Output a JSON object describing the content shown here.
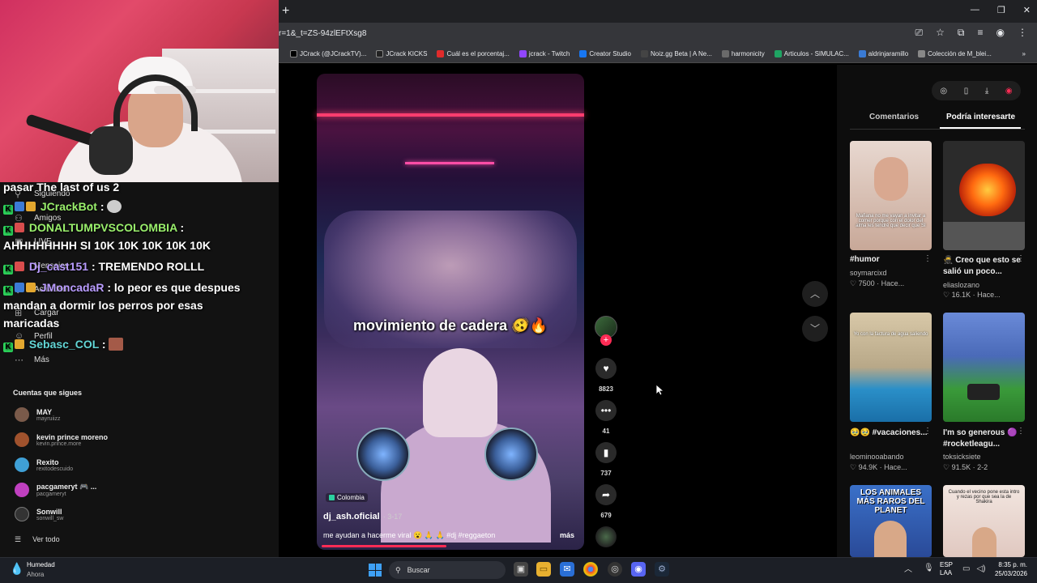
{
  "browser": {
    "url": "r=1&_t=ZS-94zlEFtXsg8",
    "bookmarks": [
      {
        "label": "JCrack (@JCrackTV)...",
        "color": "#000000"
      },
      {
        "label": "JCrack KICKS",
        "color": "#222222"
      },
      {
        "label": "Cuál es el porcentaj...",
        "color": "#e02b2b"
      },
      {
        "label": "jcrack - Twitch",
        "color": "#9146ff"
      },
      {
        "label": "Creator Studio",
        "color": "#1877f2"
      },
      {
        "label": "Noiz.gg Beta | A Ne...",
        "color": "#444444"
      },
      {
        "label": "harmonicity",
        "color": "#6a6a6a"
      },
      {
        "label": "Articulos - SIMULAC...",
        "color": "#1fa463"
      },
      {
        "label": "aldrinjaramillo",
        "color": "#3a7bd5"
      },
      {
        "label": "Colección de M_blei...",
        "color": "#888888"
      }
    ]
  },
  "sidebar": {
    "nav": [
      {
        "label": "Siguiendo",
        "icon": "following-icon"
      },
      {
        "label": "Amigos",
        "icon": "friends-icon"
      },
      {
        "label": "LIVE",
        "icon": "live-icon"
      },
      {
        "label": "Mensajes",
        "icon": "messages-icon"
      },
      {
        "label": "Actividad",
        "icon": "activity-icon"
      },
      {
        "label": "Cargar",
        "icon": "upload-icon"
      },
      {
        "label": "Perfil",
        "icon": "profile-icon"
      },
      {
        "label": "Más",
        "icon": "more-icon"
      }
    ],
    "following_title": "Cuentas que sigues",
    "accounts": [
      {
        "name": "MAY",
        "handle": "mayruiizz",
        "color": "#7a5a4a"
      },
      {
        "name": "kevin prince moreno",
        "handle": "kevin.prince.more",
        "color": "#a0522d"
      },
      {
        "name": "Rexito",
        "handle": "rexitodescuido",
        "color": "#3fa0d6"
      },
      {
        "name": "pacgameryt 🎮 ...",
        "handle": "pacgameryt",
        "color": "#c040c0"
      },
      {
        "name": "Sonwill",
        "handle": "sonwill_sw",
        "color": "#333333"
      }
    ],
    "see_all": "Ver todo"
  },
  "chat": {
    "messages": [
      {
        "user": "",
        "text": "pasar The last of us 2"
      },
      {
        "user": "JCrackBot",
        "text": ":"
      },
      {
        "user": "DONALTUMPVSCOLOMBIA",
        "text": ":"
      },
      {
        "user": "",
        "text": "AHHHHHHHH SI 10K 10K 10K 10K 10K"
      },
      {
        "user": "Dj_cast151",
        "text": ": TREMENDO ROLLL"
      },
      {
        "user": "JMoncadaR",
        "text": ": lo peor es que despues"
      },
      {
        "user": "",
        "text": "mandan a dormir los perros por esas"
      },
      {
        "user": "",
        "text": "maricadas"
      },
      {
        "user": "Sebasc_COL",
        "text": ":"
      }
    ]
  },
  "video": {
    "overlay_caption": "movimiento de cadera 🫨🔥",
    "location": "Colombia",
    "author": "dj_ash.oficial",
    "date": "· 3-17",
    "description": "me ayudan a hacerme viral 😮 🙏 🙏 #dj #reggaeton",
    "more": "más",
    "progress_fraction": 0.47
  },
  "actions": {
    "likes": "8823",
    "comments": "41",
    "saves": "737",
    "shares": "679"
  },
  "panel": {
    "tab_comments": "Comentarios",
    "tab_recommended": "Podría interesarte",
    "thumb_texts": {
      "t1": "Mañana no me vayan a invitar a comer porque con el dolor del alma les tendré que decir que SI",
      "t3": "Yo con la factura de agua saliendo",
      "t5": "LOS ANIMALES MÁS RAROS DEL PLANET",
      "t6": "Cuando el vecino pone esta intro y rezas por que sea la de Shakira"
    },
    "items": [
      {
        "title": "#humor",
        "author": "soymarcixd",
        "stats": "♡ 7500 · Hace..."
      },
      {
        "title": "🥷 Creo que esto se salió un poco...",
        "author": "eliaslozano",
        "stats": "♡ 16.1K · Hace..."
      },
      {
        "title": "🥹🥹 #vacaciones...",
        "author": "leominooabando",
        "stats": "♡ 94.9K · Hace..."
      },
      {
        "title": "I'm so generous 🟣 #rocketleagu...",
        "author": "toksicksiete",
        "stats": "♡ 91.5K · 2-2"
      }
    ]
  },
  "taskbar": {
    "weather_title": "Humedad",
    "weather_sub": "Ahora",
    "search": "Buscar",
    "lang1": "ESP",
    "lang2": "LAA",
    "time": "8:35 p. m.",
    "date": "25/03/2026"
  }
}
